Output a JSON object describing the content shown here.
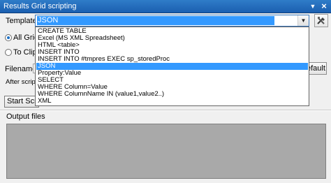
{
  "window": {
    "title": "Results Grid scripting",
    "menu_icon": "triangle-down-icon",
    "close_icon": "close-icon"
  },
  "template": {
    "label": "Template:",
    "selected": "JSON",
    "options": [
      "CREATE TABLE",
      "Excel (MS XML Spreadsheet)",
      "HTML <table>",
      "INSERT INTO",
      "INSERT INTO #tmpres EXEC sp_storedProc",
      "JSON",
      "Property:Value",
      "SELECT",
      "WHERE Column=Value",
      "WHERE ColumnName IN (value1,value2..)",
      "XML"
    ],
    "tool_icon": "tools-icon"
  },
  "scope": {
    "all_grids_label": "All Grids",
    "clipboard_label": "To Clipbo"
  },
  "filename": {
    "label": "Filename:",
    "default_button": "efault"
  },
  "after_scripting_label": "After scripting",
  "start_button": "Start Scripti",
  "output": {
    "label": "Output files"
  },
  "colors": {
    "titlebar": "#1f66b8",
    "selection": "#3399ff",
    "output_area": "#a9a9a9"
  }
}
